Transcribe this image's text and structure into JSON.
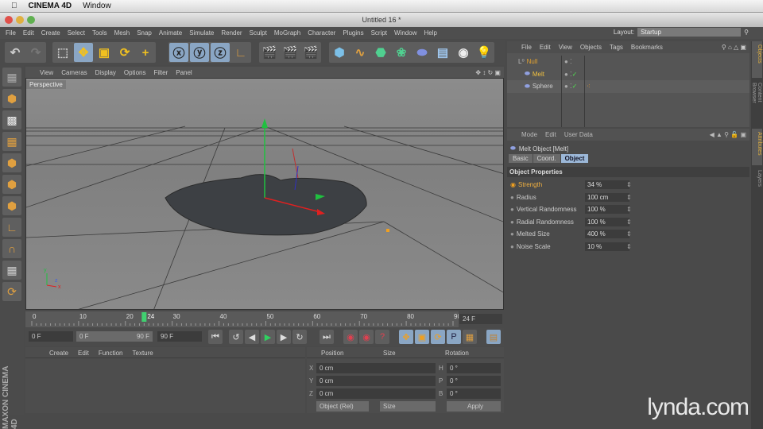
{
  "mac_menu": {
    "app": "CINEMA 4D",
    "window": "Window"
  },
  "window": {
    "title": "Untitled 16 *"
  },
  "menu": [
    "File",
    "Edit",
    "Create",
    "Select",
    "Tools",
    "Mesh",
    "Snap",
    "Animate",
    "Simulate",
    "Render",
    "Sculpt",
    "MoGraph",
    "Character",
    "Plugins",
    "Script",
    "Window",
    "Help"
  ],
  "layout": {
    "label": "Layout:",
    "value": "Startup"
  },
  "viewport": {
    "menu": [
      "View",
      "Cameras",
      "Display",
      "Options",
      "Filter",
      "Panel"
    ],
    "label": "Perspective"
  },
  "timeline": {
    "ticks": [
      "0",
      "10",
      "20",
      "30",
      "40",
      "50",
      "60",
      "70",
      "80",
      "90"
    ],
    "current": "24",
    "fps": "24 F"
  },
  "transport": {
    "start": "0 F",
    "range_start": "0 F",
    "range_end": "90 F",
    "end": "90 F"
  },
  "material_manager": {
    "menu": [
      "Create",
      "Edit",
      "Function",
      "Texture"
    ]
  },
  "coordinates": {
    "headers": [
      "Position",
      "Size",
      "Rotation"
    ],
    "rows": [
      {
        "axis": "X",
        "pos": "0 cm",
        "rot_axis": "H",
        "rot": "0 °"
      },
      {
        "axis": "Y",
        "pos": "0 cm",
        "rot_axis": "P",
        "rot": "0 °"
      },
      {
        "axis": "Z",
        "pos": "0 cm",
        "rot_axis": "B",
        "rot": "0 °"
      }
    ],
    "mode": "Object (Rel)",
    "size_mode": "Size",
    "apply": "Apply"
  },
  "object_manager": {
    "menu": [
      "File",
      "Edit",
      "View",
      "Objects",
      "Tags",
      "Bookmarks"
    ],
    "objects": [
      {
        "name": "Null",
        "color": "#e0a030"
      },
      {
        "name": "Melt",
        "color": "#f0c040"
      },
      {
        "name": "Sphere",
        "color": "#cfcfcf"
      }
    ]
  },
  "attributes": {
    "menu": [
      "Mode",
      "Edit",
      "User Data"
    ],
    "title": "Melt Object [Melt]",
    "tabs": [
      "Basic",
      "Coord.",
      "Object"
    ],
    "active_tab": "Object",
    "section": "Object Properties",
    "props": [
      {
        "label": "Strength",
        "value": "34 %"
      },
      {
        "label": "Radius",
        "value": "100 cm"
      },
      {
        "label": "Vertical Randomness",
        "value": "100 %"
      },
      {
        "label": "Radial Randomness",
        "value": "100 %"
      },
      {
        "label": "Melted Size",
        "value": "400 %"
      },
      {
        "label": "Noise Scale",
        "value": "10 %"
      }
    ]
  },
  "side_tabs": [
    "Objects",
    "Content Browser",
    "Attributes",
    "Layers"
  ],
  "branding": {
    "maxon": "MAXON CINEMA 4D",
    "watermark": "lynda.com"
  }
}
